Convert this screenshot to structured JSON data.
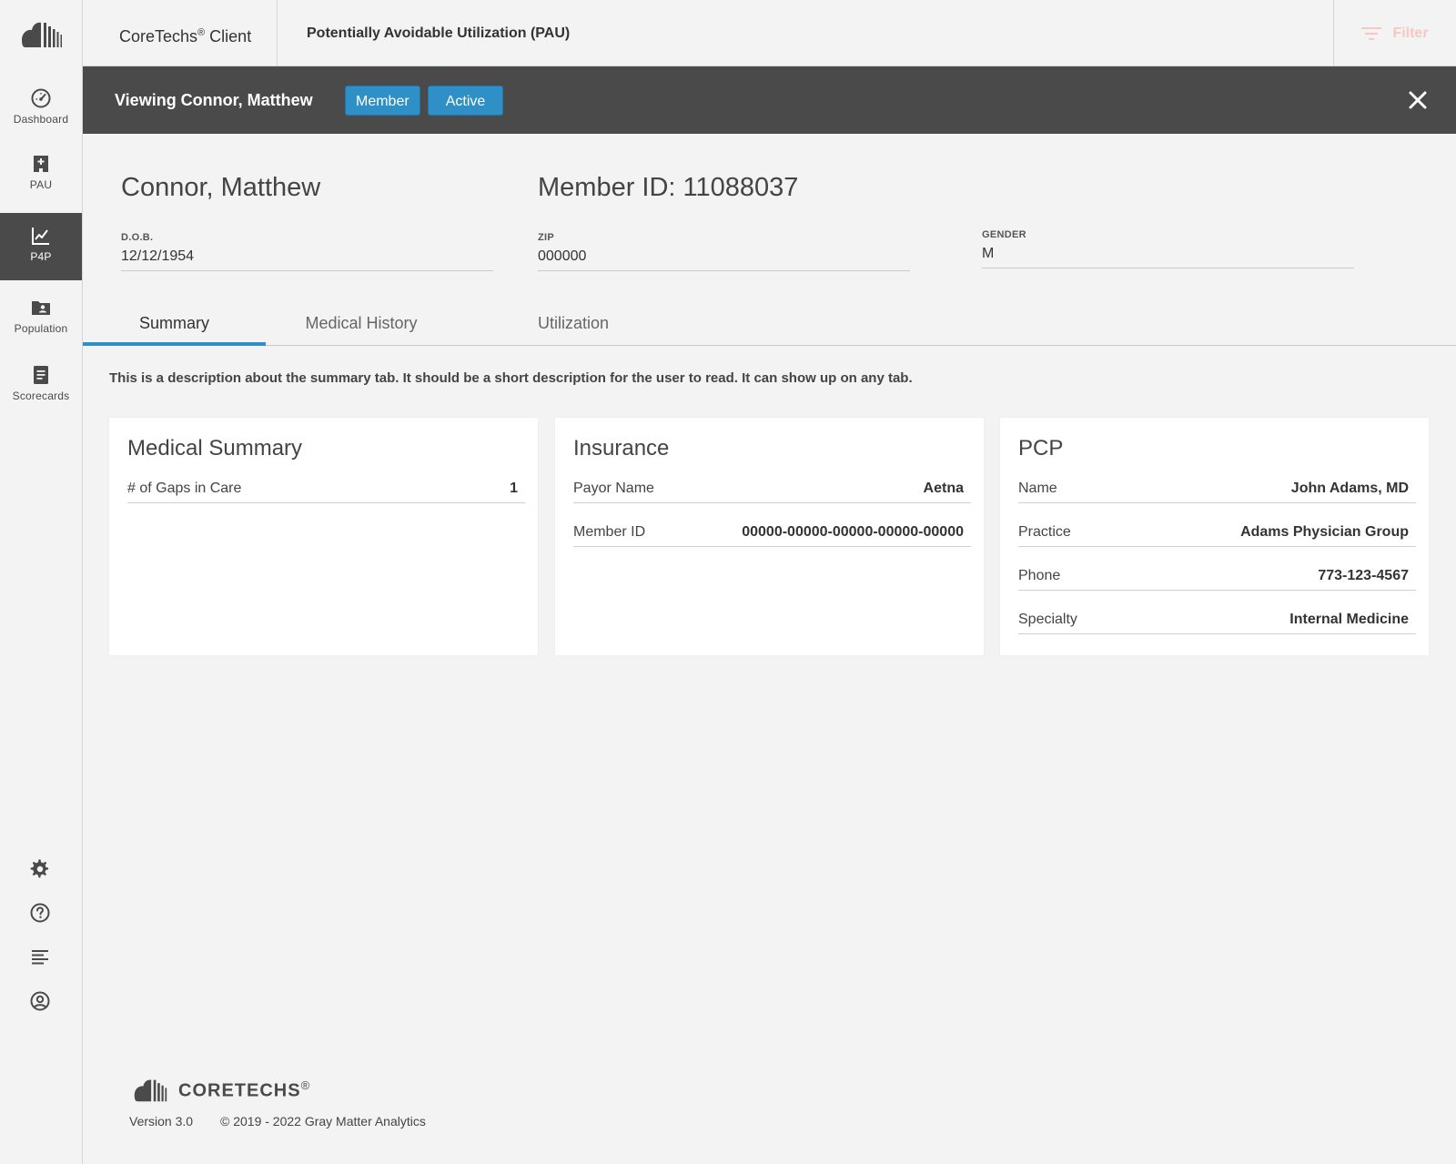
{
  "app": {
    "brand_name": "CoreTechs",
    "brand_reg": "®",
    "brand_suffix": "Client",
    "page_title": "Potentially Avoidable Utilization (PAU)",
    "filter_label": "Filter"
  },
  "sidebar": {
    "items": [
      {
        "label": "Dashboard",
        "icon": "speedometer-icon"
      },
      {
        "label": "PAU",
        "icon": "hospital-icon"
      },
      {
        "label": "P4P",
        "icon": "line-chart-icon",
        "active": true
      },
      {
        "label": "Population",
        "icon": "folder-user-icon"
      },
      {
        "label": "Scorecards",
        "icon": "document-icon"
      }
    ],
    "utility_icons": [
      "gear-icon",
      "help-icon",
      "align-left-icon",
      "user-circle-icon"
    ]
  },
  "viewbar": {
    "title": "Viewing Connor, Matthew",
    "badge_member": "Member",
    "badge_active": "Active"
  },
  "member": {
    "name": "Connor, Matthew",
    "member_id": "Member ID: 11088037",
    "dob_label": "D.O.B.",
    "dob": "12/12/1954",
    "zip_label": "ZIP",
    "zip": "000000",
    "gender_label": "GENDER",
    "gender": "M"
  },
  "tabs": [
    "Summary",
    "Medical History",
    "Utilization"
  ],
  "active_tab": "Summary",
  "description": "This is a description about the summary tab. It should be a short description for the user to read. It can show up on any tab.",
  "cards": {
    "medical": {
      "title": "Medical Summary",
      "rows": [
        {
          "label": "# of Gaps in Care",
          "value": "1"
        }
      ]
    },
    "insurance": {
      "title": "Insurance",
      "rows": [
        {
          "label": "Payor Name",
          "value": "Aetna"
        },
        {
          "label": "Member ID",
          "value": "00000-00000-00000-00000-00000"
        }
      ]
    },
    "pcp": {
      "title": "PCP",
      "rows": [
        {
          "label": "Name",
          "value": "John Adams, MD"
        },
        {
          "label": "Practice",
          "value": "Adams Physician Group"
        },
        {
          "label": "Phone",
          "value": "773-123-4567"
        },
        {
          "label": "Specialty",
          "value": "Internal Medicine"
        }
      ]
    }
  },
  "footer": {
    "brand": "CORETECHS",
    "brand_reg": "®",
    "version": "Version 3.0",
    "copyright": "© 2019 - 2022 Gray Matter Analytics"
  },
  "colors": {
    "accent": "#2f8fc7",
    "header_dark": "#4a4a4a",
    "background": "#f3f3f3",
    "filter_text": "#f6c8bf"
  }
}
